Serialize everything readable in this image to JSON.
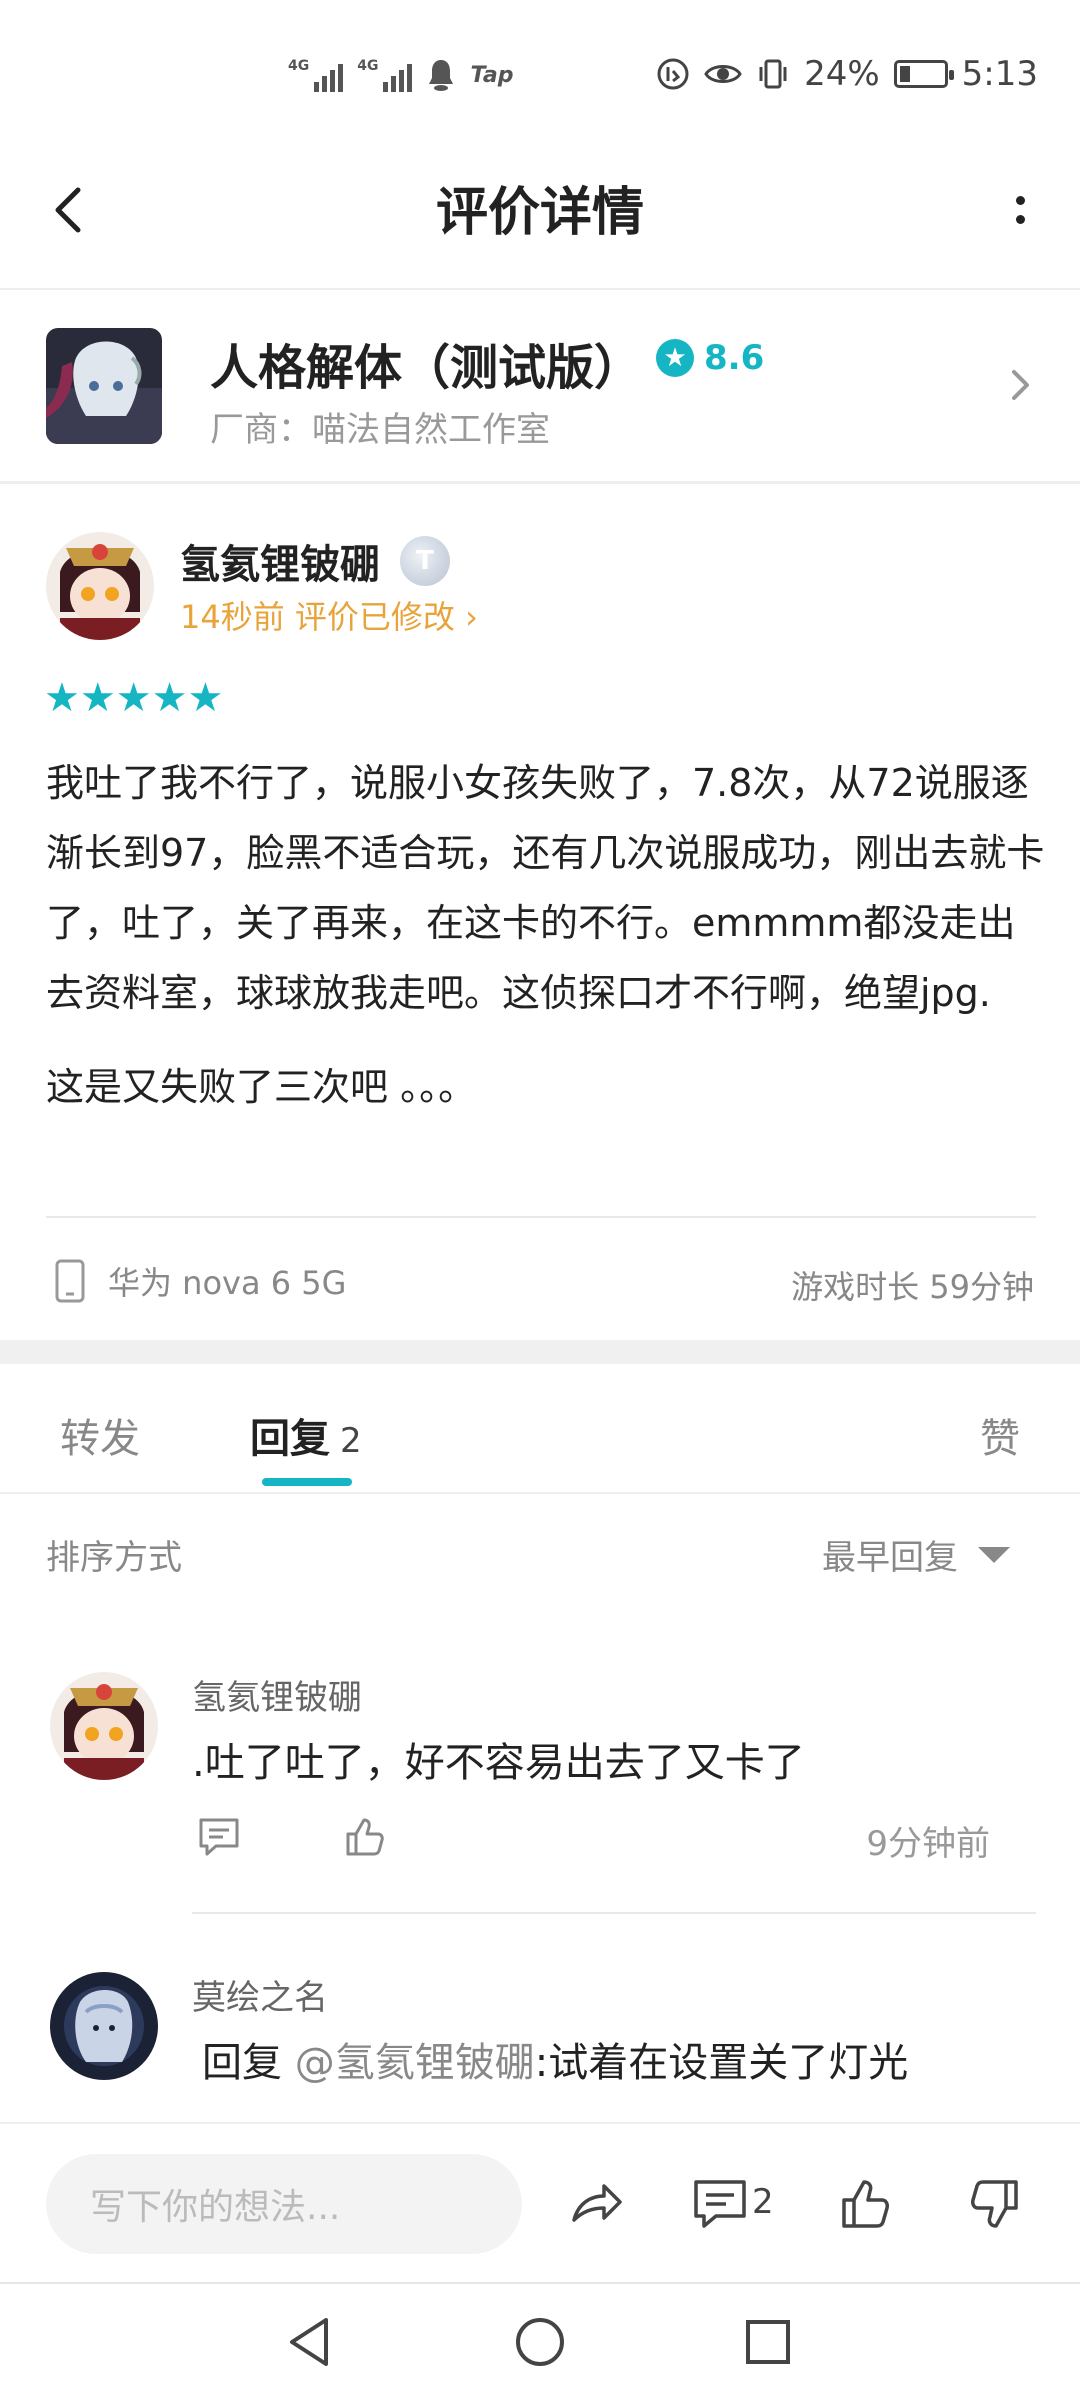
{
  "status_bar": {
    "network_1": "4G",
    "network_2": "4G",
    "app_badge": "Tap",
    "battery_percent": "24%",
    "battery_level": 0.24,
    "time": "5:13"
  },
  "header": {
    "title": "评价详情"
  },
  "app_card": {
    "name": "人格解体（测试版）",
    "score": "8.6",
    "vendor": "厂商：喵法自然工作室"
  },
  "review": {
    "user": "氢氦锂铍硼",
    "level_badge": "T",
    "meta": "14秒前 评价已修改",
    "meta_chevron": "›",
    "rating": 5,
    "stars": "★★★★★",
    "paragraph1": "我吐了我不行了，说服小女孩失败了，7.8次，从72说服逐渐长到97，脸黑不适合玩，还有几次说服成功，刚出去就卡了，吐了，关了再来，在这卡的不行。emmmm都没走出去资料室，球球放我走吧。这侦探口才不行啊，绝望jpg.",
    "paragraph2": "这是又失败了三次吧 。。。",
    "device": "华为 nova 6 5G",
    "playtime": "游戏时长 59分钟"
  },
  "tabs": {
    "forward": "转发",
    "reply": "回复",
    "reply_count": "2",
    "like": "赞"
  },
  "sort": {
    "label": "排序方式",
    "value": "最早回复"
  },
  "replies": [
    {
      "user": "氢氦锂铍硼",
      "text": ".吐了吐了，好不容易出去了又卡了",
      "time": "9分钟前"
    },
    {
      "user": "莫绘之名",
      "prefix": "回复 ",
      "mention": "@氢氦锂铍硼",
      "text": ":试着在设置关了灯光"
    }
  ],
  "bottom_bar": {
    "placeholder": "写下你的想法...",
    "comment_count": "2"
  },
  "colors": {
    "accent": "#15b5c4",
    "meta_orange": "#e8a43a"
  }
}
